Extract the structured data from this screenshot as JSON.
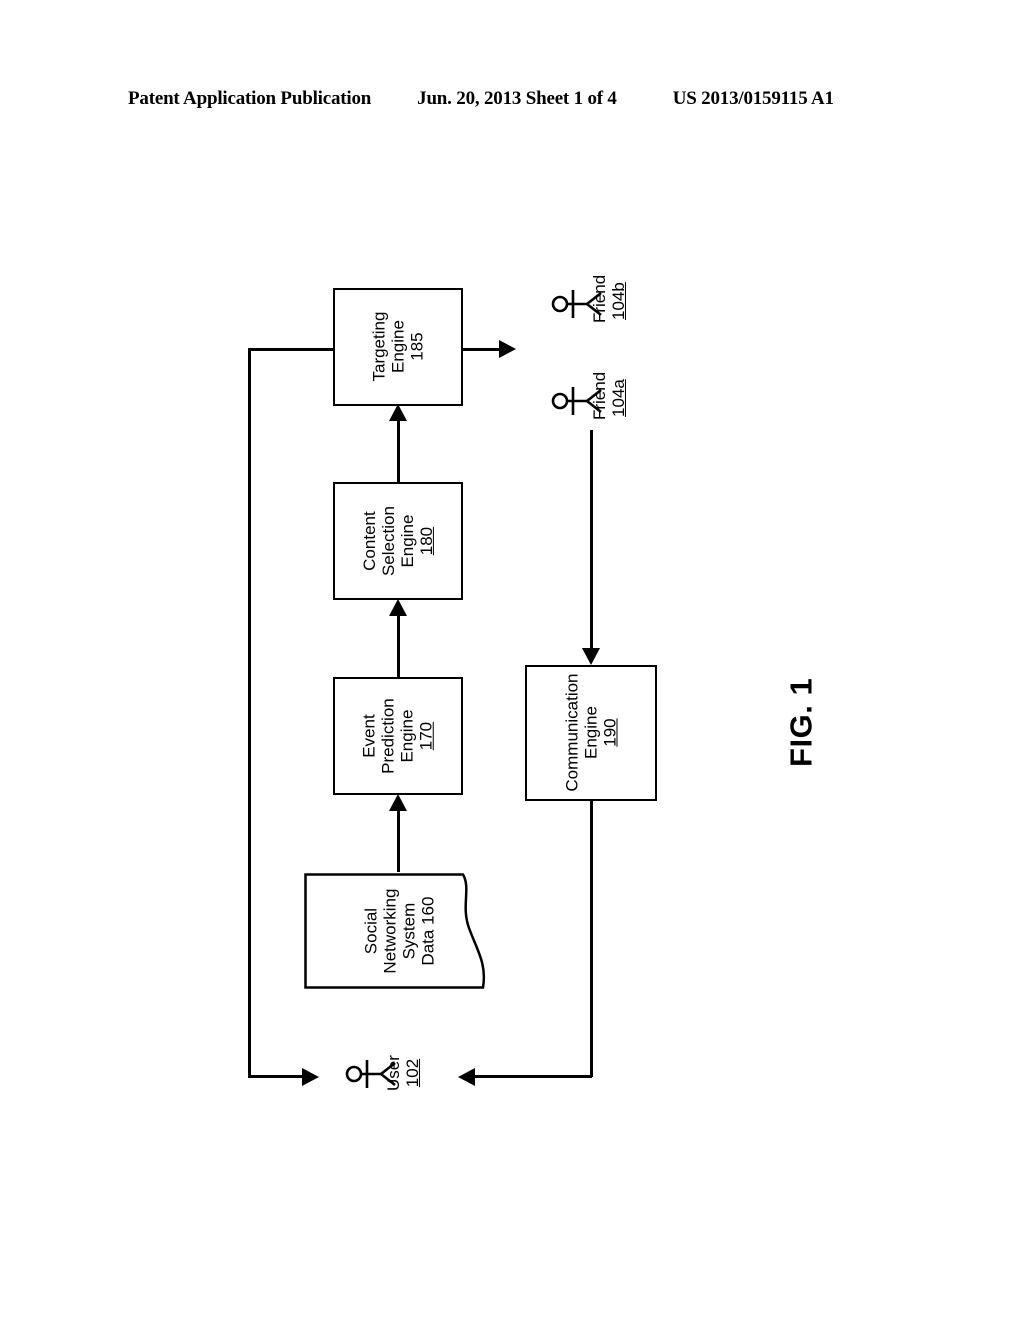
{
  "header": {
    "publication": "Patent Application Publication",
    "date_sheet": "Jun. 20, 2013  Sheet 1 of 4",
    "patent_number": "US 2013/0159115 A1"
  },
  "figure": {
    "caption": "FIG. 1"
  },
  "colors": {
    "ink": "#000000",
    "page": "#ffffff"
  },
  "blocks": {
    "targeting_engine": {
      "line1": "Targeting",
      "line2": "Engine",
      "ref": "185"
    },
    "content_selection_engine": {
      "line1": "Content",
      "line2": "Selection",
      "line3": "Engine",
      "ref": "180"
    },
    "event_prediction_engine": {
      "line1": "Event",
      "line2": "Prediction",
      "line3": "Engine",
      "ref": "170"
    },
    "communication_engine": {
      "line1": "Communication",
      "line2": "Engine",
      "ref": "190"
    },
    "social_networking_data": {
      "line1": "Social",
      "line2": "Networking",
      "line3": "System",
      "line4": "Data",
      "ref": "160"
    }
  },
  "actors": {
    "user": {
      "label": "User",
      "ref": "102"
    },
    "friend_a": {
      "label": "Friend",
      "ref": "104a"
    },
    "friend_b": {
      "label": "Friend",
      "ref": "104b"
    }
  }
}
